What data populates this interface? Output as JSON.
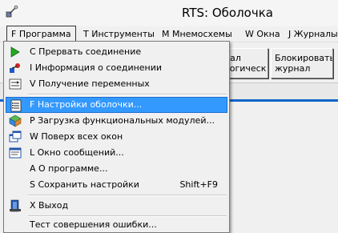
{
  "window": {
    "title": "RTS: Оболочка"
  },
  "menubar": {
    "items": [
      {
        "label": "F Программа"
      },
      {
        "label": "T Инструменты"
      },
      {
        "label": "M Мнемосхемы"
      },
      {
        "label": "W Окна"
      },
      {
        "label": "J Журналы"
      }
    ]
  },
  "toolbar": {
    "journal_btn": "рнал\nологическ",
    "block_btn": "Блокировать\nжурнал"
  },
  "dropdown": {
    "items": [
      {
        "label": "C Прервать соединение",
        "icon": "arrow-icon"
      },
      {
        "label": "I Информация о соединении",
        "icon": "connection-info-icon"
      },
      {
        "label": "V Получение переменных",
        "icon": "variables-icon"
      },
      {
        "label": "F Настройки оболочки...",
        "icon": "settings-list-icon"
      },
      {
        "label": "P Загрузка функциональных модулей...",
        "icon": "modules-icon"
      },
      {
        "label": "W Поверх всех окон",
        "icon": "windows-icon"
      },
      {
        "label": "L Окно сообщений...",
        "icon": "messages-icon"
      },
      {
        "label": "A О программе..."
      },
      {
        "label": "S Сохранить настройки",
        "shortcut": "Shift+F9"
      },
      {
        "label": "X Выход",
        "icon": "exit-icon"
      },
      {
        "label": "Тест совершения ошибки..."
      }
    ]
  }
}
